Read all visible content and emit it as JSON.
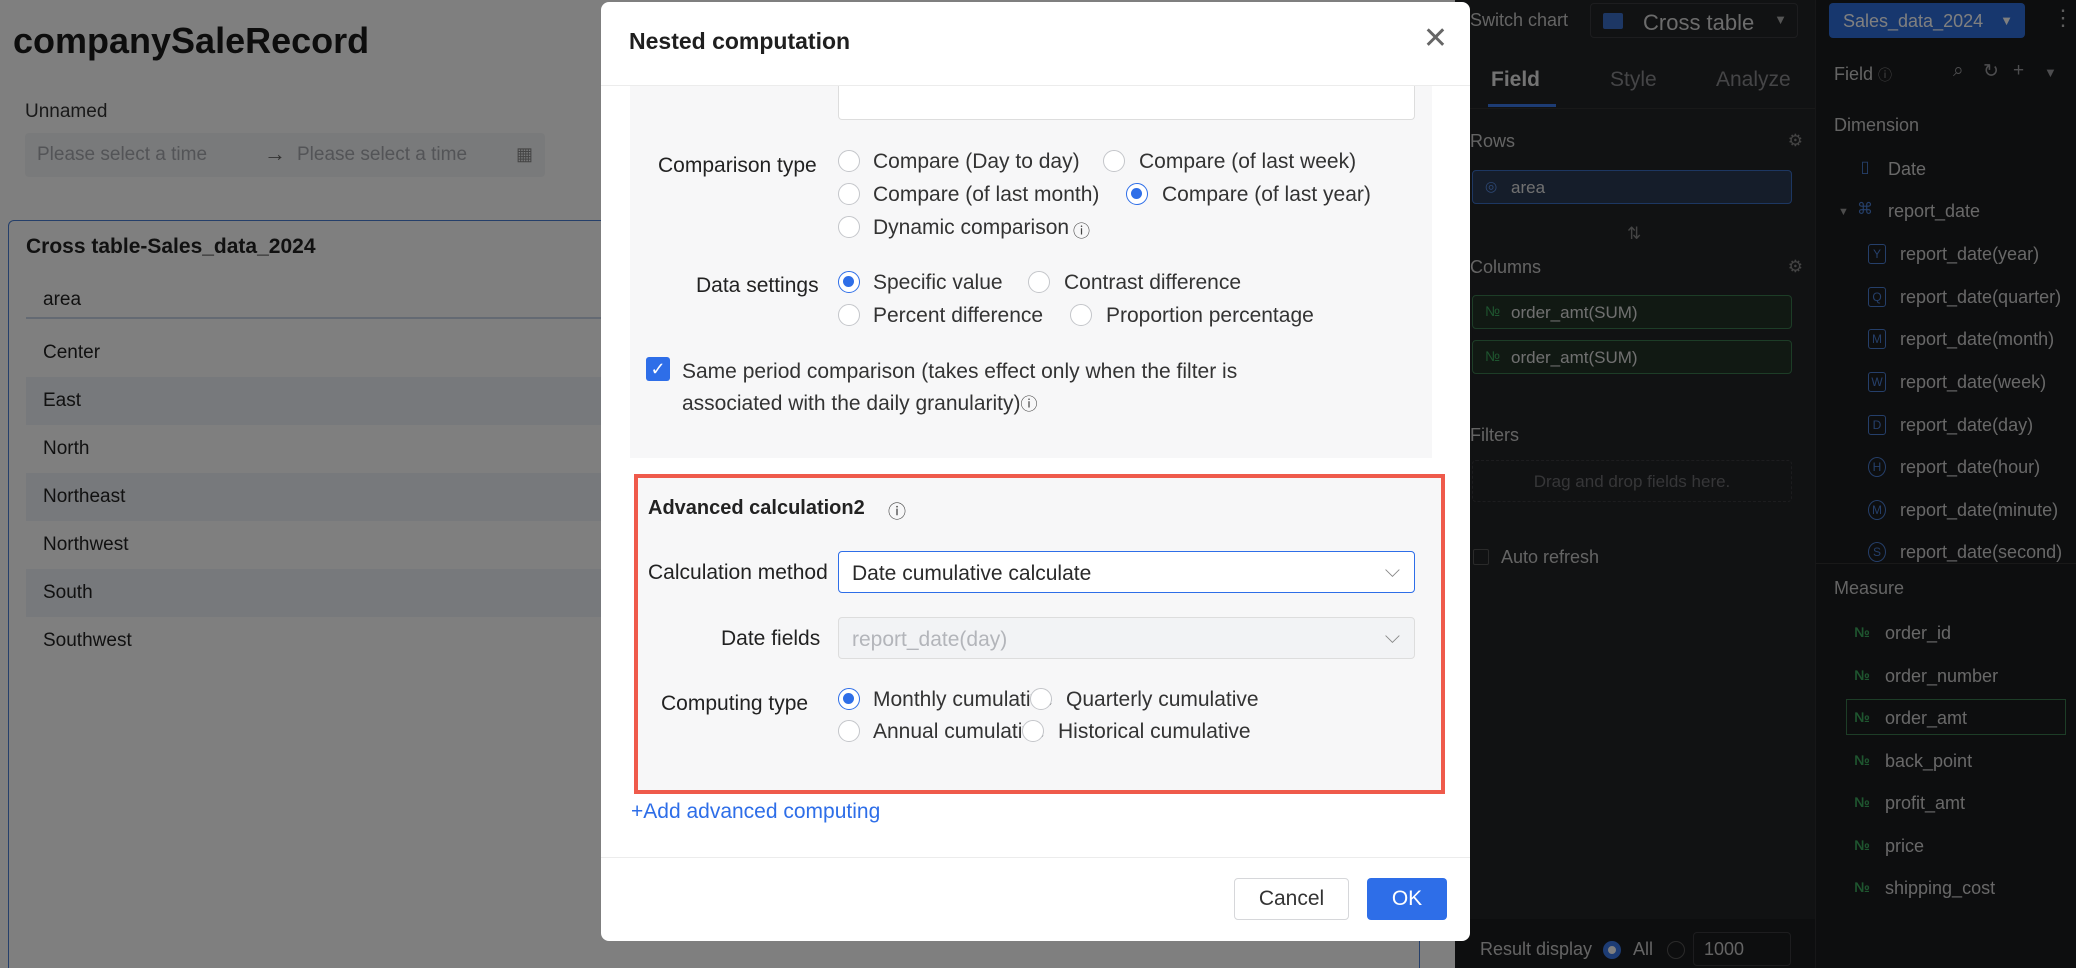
{
  "page": {
    "title": "companySaleRecord",
    "filter_label": "Unnamed",
    "date_start_placeholder": "Please select a time",
    "date_end_placeholder": "Please select a time"
  },
  "card": {
    "title": "Cross table-Sales_data_2024",
    "column_header": "area",
    "rows": [
      "Center",
      "East",
      "North",
      "Northeast",
      "Northwest",
      "South",
      "Southwest"
    ]
  },
  "config_panel": {
    "switch_chart_label": "Switch chart",
    "chart_type": "Cross table",
    "tabs": [
      "Field",
      "Style",
      "Analyze"
    ],
    "active_tab": "Field",
    "rows_label": "Rows",
    "rows_fields": [
      "area"
    ],
    "columns_label": "Columns",
    "columns_fields": [
      "order_amt(SUM)",
      "order_amt(SUM)"
    ],
    "filters_label": "Filters",
    "filters_placeholder": "Drag and drop fields here.",
    "auto_refresh_label": "Auto refresh",
    "result_display_label": "Result display",
    "result_all_label": "All",
    "result_count": "1000"
  },
  "field_panel": {
    "dataset": "Sales_data_2024",
    "field_label": "Field",
    "dimension_label": "Dimension",
    "dimensions": [
      {
        "name": "Date",
        "icon": "document-icon"
      },
      {
        "name": "report_date",
        "icon": "hierarchy-icon"
      },
      {
        "name": "report_date(year)",
        "icon": "Y"
      },
      {
        "name": "report_date(quarter)",
        "icon": "Q"
      },
      {
        "name": "report_date(month)",
        "icon": "M"
      },
      {
        "name": "report_date(week)",
        "icon": "W"
      },
      {
        "name": "report_date(day)",
        "icon": "D"
      },
      {
        "name": "report_date(hour)",
        "icon": "H"
      },
      {
        "name": "report_date(minute)",
        "icon": "M"
      },
      {
        "name": "report_date(second)",
        "icon": "S"
      }
    ],
    "measure_label": "Measure",
    "measures": [
      "order_id",
      "order_number",
      "order_amt",
      "back_point",
      "profit_amt",
      "price",
      "shipping_cost"
    ],
    "highlighted_measure": "order_amt"
  },
  "modal": {
    "title": "Nested computation",
    "comparison_type_label": "Comparison type",
    "comparison_options": [
      "Compare (Day to day)",
      "Compare (of last week)",
      "Compare (of last month)",
      "Compare (of last year)",
      "Dynamic comparison"
    ],
    "comparison_selected": "Compare (of last year)",
    "data_settings_label": "Data settings",
    "data_options": [
      "Specific value",
      "Contrast difference",
      "Percent difference",
      "Proportion percentage"
    ],
    "data_selected": "Specific value",
    "same_period_text": "Same period comparison (takes effect only when the filter is associated with the daily granularity)",
    "same_period_checked": true,
    "advanced_title": "Advanced calculation2",
    "calc_method_label": "Calculation method",
    "calc_method_value": "Date cumulative calculate",
    "date_fields_label": "Date fields",
    "date_fields_value": "report_date(day)",
    "computing_type_label": "Computing type",
    "computing_options": [
      "Monthly cumulative",
      "Quarterly cumulative",
      "Annual cumulative",
      "Historical cumulative"
    ],
    "computing_selected": "Monthly cumulative",
    "add_advanced": "+Add advanced computing",
    "cancel": "Cancel",
    "ok": "OK"
  },
  "colors": {
    "accent": "#2e6ee8",
    "highlight_border": "#ef5a4b",
    "measure_green": "#3daa5e",
    "panel_dark": "#232426"
  }
}
